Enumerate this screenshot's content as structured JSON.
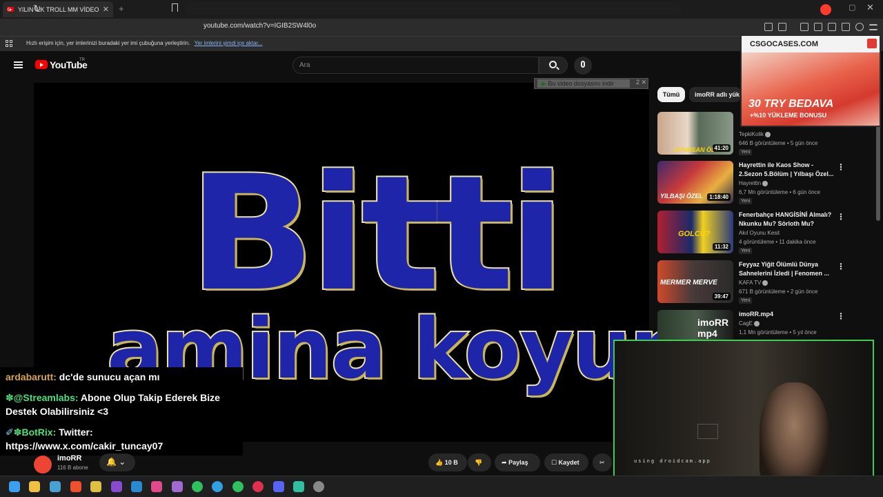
{
  "browser": {
    "tab_title": "YILIN İLK TROLL MM VİDEOSU -",
    "url": "youtube.com/watch?v=IGIB2SW4l0o",
    "bookmarks_text": "Hızlı erişim için, yer imlerinizi buradaki yer imi çubuğuna yerleştirin.",
    "bookmarks_link": "Yer imlerini şimdi içe aktar..."
  },
  "youtube": {
    "logo_text": "YouTube",
    "logo_region": "TR",
    "search_placeholder": "Ara"
  },
  "video": {
    "title_line_1": "Bitti",
    "title_line_2": "amina koyum",
    "download_banner": "Bu video dosyasını indir",
    "download_count": "2"
  },
  "chat": [
    {
      "user": "ardabarutt:",
      "text": " dc'de sunucu açan mı"
    },
    {
      "user": "@Streamlabs:",
      "text": " Abone Olup Takip Ederek Bize Destek Olabilirsiniz <3"
    },
    {
      "user": "BotRix:",
      "text": " Twitter: https://www.x.com/cakir_tuncay07"
    }
  ],
  "channel": {
    "name": "imoRR",
    "subscribers": "116 B abone"
  },
  "actions": {
    "likes": "10 B",
    "share": "Paylaş",
    "save": "Kaydet"
  },
  "sidebar": {
    "chip_all": "Tümü",
    "chip_user": "imoRR adlı yük",
    "items": [
      {
        "title": "",
        "channel": "TepkiKolik",
        "meta": "646 B görüntüleme • 5 gün önce",
        "badge": "Yeni",
        "duration": "41:20",
        "thumb_text": "UYURSAN ÖLÜ"
      },
      {
        "title": "Hayrettin ile Kaos Show - 2.Sezon 5.Bölüm | Yılbaşı Özel...",
        "channel": "Hayrettin",
        "meta": "6,7 Mn görüntüleme • 6 gün önce",
        "badge": "Yeni",
        "duration": "1:18:40",
        "thumb_text": "YILBAŞI ÖZEL"
      },
      {
        "title": "Fenerbahçe HANGİSİNİ Almalı? Nkunku Mu? Sörloth Mu?",
        "channel": "Akıl Oyunu Kesit",
        "meta": "4 görüntüleme • 11 dakika önce",
        "badge": "Yeni",
        "duration": "11:32",
        "thumb_text": "GOLCÜ?"
      },
      {
        "title": "Feyyaz Yiğit Ölümlü Dünya Sahnelerini İzledi | Fenomen ...",
        "channel": "KAFA TV",
        "meta": "671 B görüntüleme • 2 gün önce",
        "badge": "Yeni",
        "duration": "39:47",
        "thumb_text": "MERMER MERVE"
      },
      {
        "title": "imoRR.mp4",
        "channel": "CagE",
        "meta": "1,1 Mn görüntüleme • 5 yıl önce",
        "badge": "",
        "duration": "",
        "thumb_text": "imoRR mp4"
      }
    ]
  },
  "ad": {
    "brand": "CSGOCASES.COM",
    "headline": "30 TRY BEDAVA",
    "subline": "+%10 YÜKLEME BONUSU"
  },
  "webcam": {
    "label": "using droidcam.app"
  },
  "colors": {
    "yt_red": "#ff0000",
    "title_blue": "#1e25a8",
    "cam_border": "#3ccf52"
  }
}
